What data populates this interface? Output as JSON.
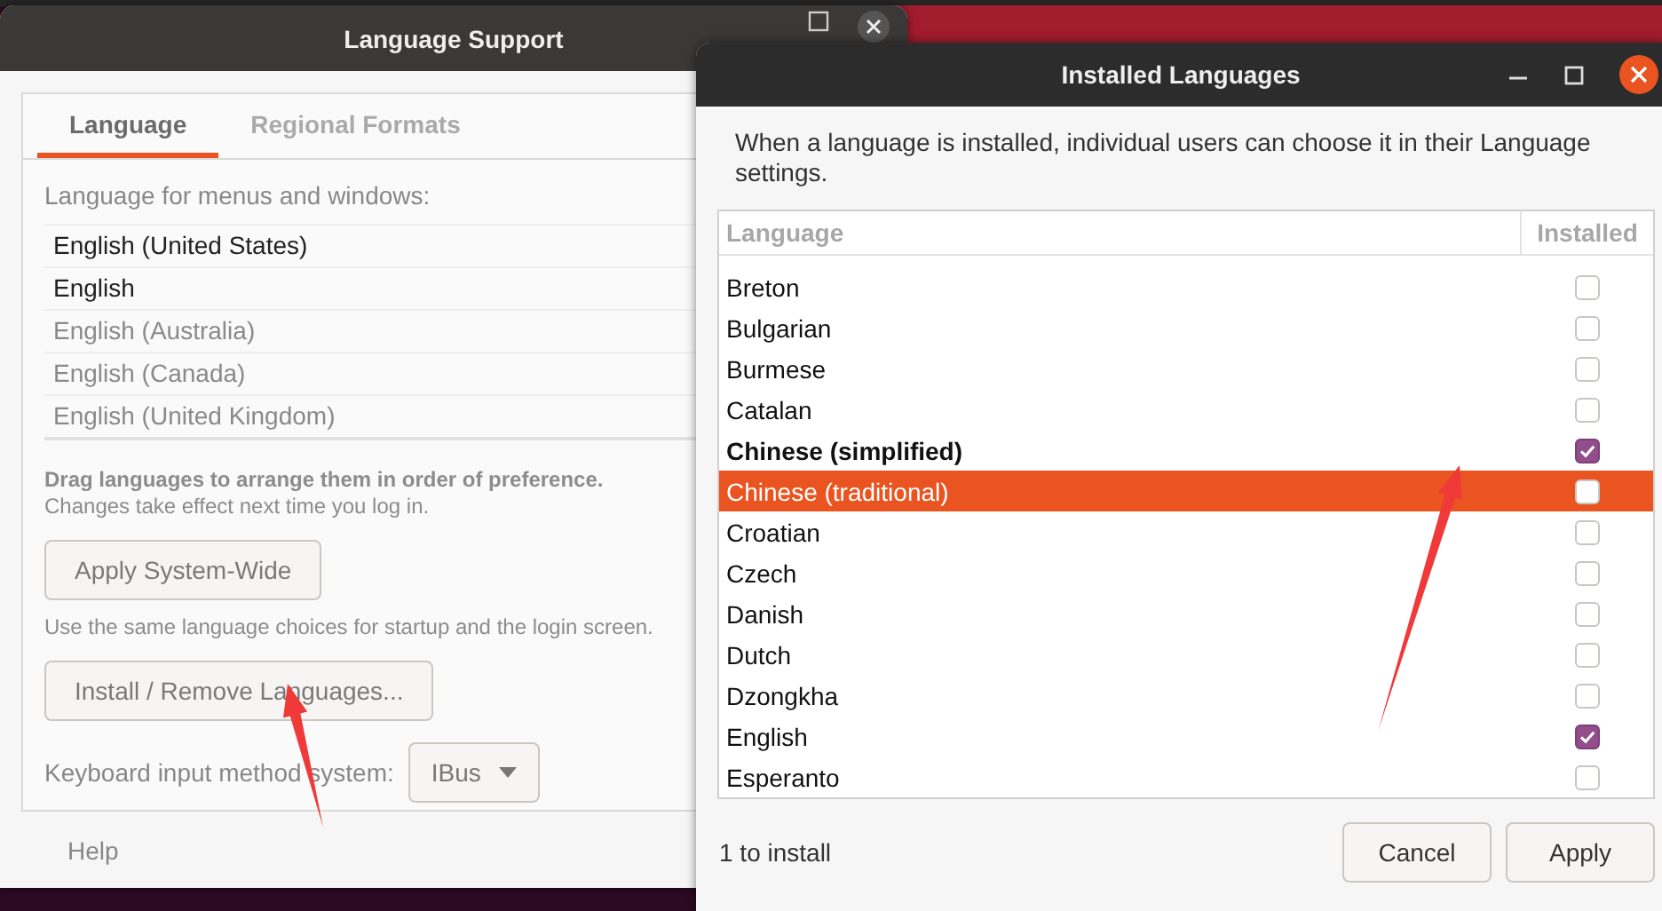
{
  "language_support": {
    "title": "Language Support",
    "tabs": [
      {
        "label": "Language",
        "selected": true
      },
      {
        "label": "Regional Formats",
        "selected": false
      }
    ],
    "list_label": "Language for menus and windows:",
    "languages": [
      {
        "name": "English (United States)",
        "dimmed": false
      },
      {
        "name": "English",
        "dimmed": false
      },
      {
        "name": "English (Australia)",
        "dimmed": true
      },
      {
        "name": "English (Canada)",
        "dimmed": true
      },
      {
        "name": "English (United Kingdom)",
        "dimmed": true
      }
    ],
    "drag_hint": "Drag languages to arrange them in order of preference.",
    "drag_note": "Changes take effect next time you log in.",
    "apply_button": "Apply System-Wide",
    "apply_note": "Use the same language choices for startup and the login screen.",
    "install_button": "Install / Remove Languages...",
    "keyboard_label": "Keyboard input method system:",
    "keyboard_value": "IBus",
    "help": "Help"
  },
  "installed_languages": {
    "title": "Installed Languages",
    "description": "When a language is installed, individual users can choose it in their Language settings.",
    "columns": [
      "Language",
      "Installed"
    ],
    "rows": [
      {
        "name": "Breton",
        "installed": false,
        "changed": false,
        "selected": false
      },
      {
        "name": "Bulgarian",
        "installed": false,
        "changed": false,
        "selected": false
      },
      {
        "name": "Burmese",
        "installed": false,
        "changed": false,
        "selected": false
      },
      {
        "name": "Catalan",
        "installed": false,
        "changed": false,
        "selected": false
      },
      {
        "name": "Chinese (simplified)",
        "installed": true,
        "changed": true,
        "selected": false
      },
      {
        "name": "Chinese (traditional)",
        "installed": false,
        "changed": false,
        "selected": true
      },
      {
        "name": "Croatian",
        "installed": false,
        "changed": false,
        "selected": false
      },
      {
        "name": "Czech",
        "installed": false,
        "changed": false,
        "selected": false
      },
      {
        "name": "Danish",
        "installed": false,
        "changed": false,
        "selected": false
      },
      {
        "name": "Dutch",
        "installed": false,
        "changed": false,
        "selected": false
      },
      {
        "name": "Dzongkha",
        "installed": false,
        "changed": false,
        "selected": false
      },
      {
        "name": "English",
        "installed": true,
        "changed": false,
        "selected": false
      },
      {
        "name": "Esperanto",
        "installed": false,
        "changed": false,
        "selected": false
      }
    ],
    "status": "1 to install",
    "buttons": [
      "Cancel",
      "Apply"
    ]
  }
}
